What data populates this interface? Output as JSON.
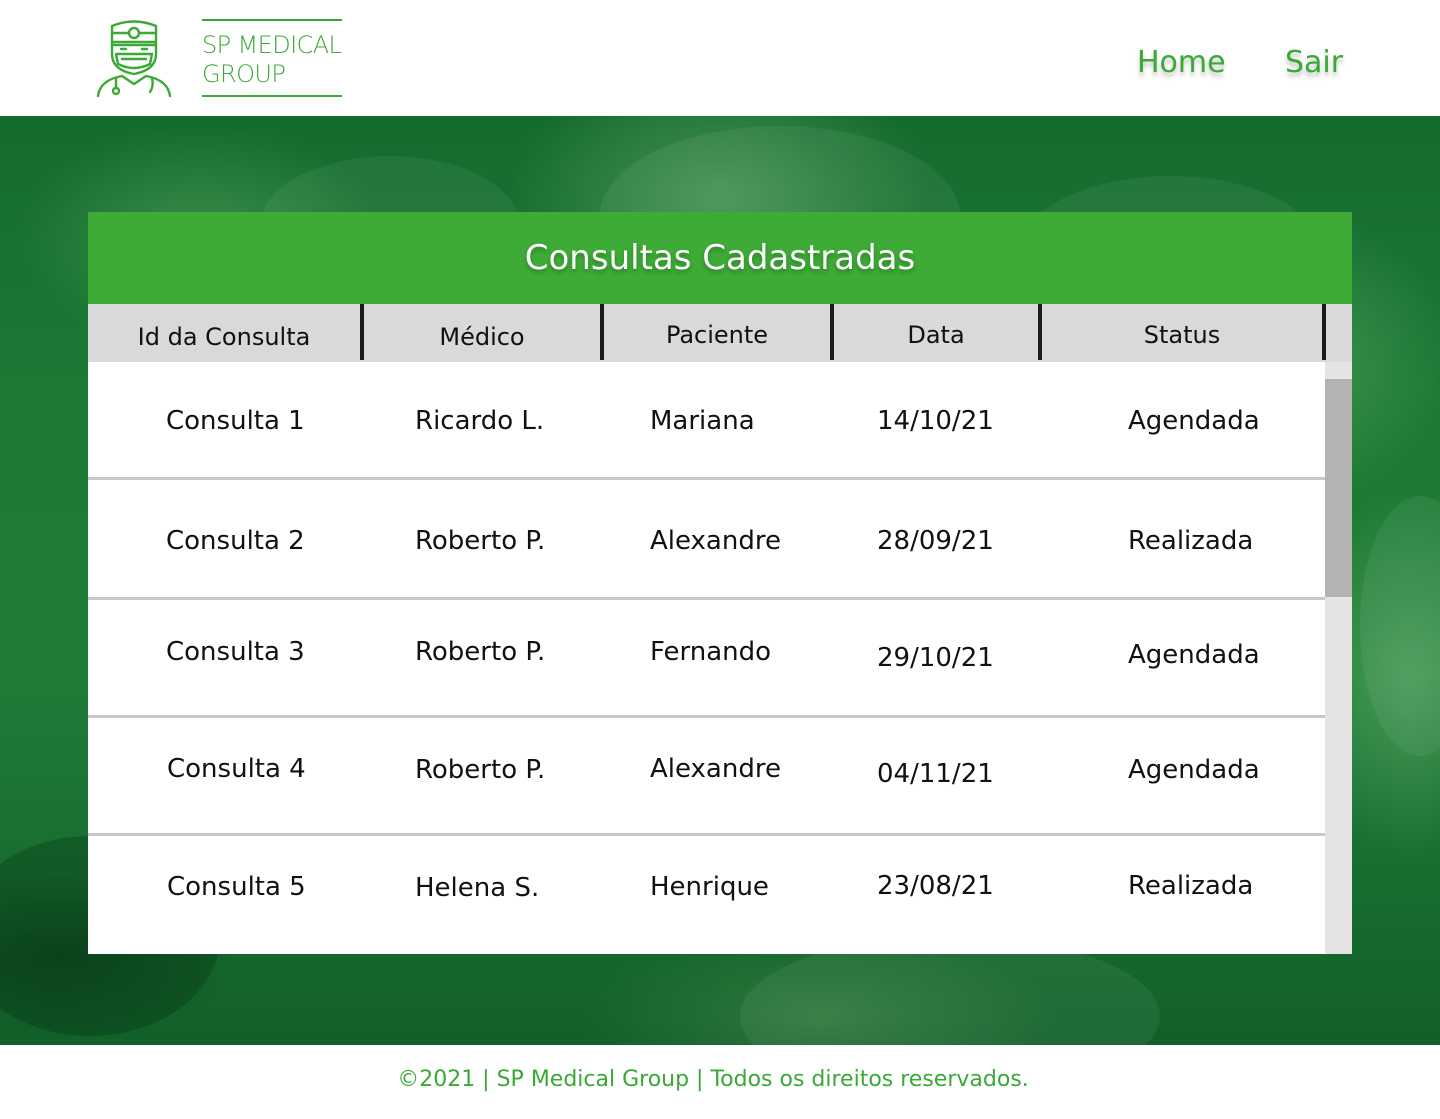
{
  "brand": {
    "line1": "SP MEDICAL",
    "line2": "GROUP",
    "icon": "doctor-icon",
    "color": "#3aa935"
  },
  "nav": {
    "home": "Home",
    "logout": "Sair"
  },
  "table": {
    "title": "Consultas Cadastradas",
    "title_color": "#3dab36",
    "columns": [
      "Id da Consulta",
      "Médico",
      "Paciente",
      "Data",
      "Status"
    ],
    "rows": [
      [
        "Consulta 1",
        "Ricardo L.",
        "Mariana",
        "14/10/21",
        "Agendada"
      ],
      [
        "Consulta 2",
        "Roberto P.",
        "Alexandre",
        "28/09/21",
        "Realizada"
      ],
      [
        "Consulta 3",
        "Roberto P.",
        "Fernando",
        "29/10/21",
        "Agendada"
      ],
      [
        "Consulta 4",
        "Roberto P.",
        "Alexandre",
        "04/11/21",
        "Agendada"
      ],
      [
        "Consulta 5",
        "Helena S.",
        "Henrique",
        "23/08/21",
        "Realizada"
      ]
    ]
  },
  "footer": {
    "text": "©2021 | SP Medical Group | Todos os direitos reservados."
  }
}
